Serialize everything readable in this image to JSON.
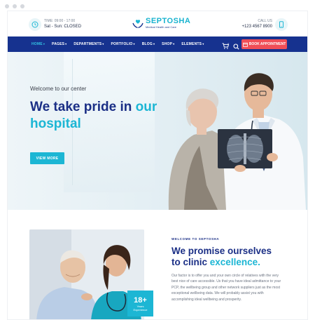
{
  "colors": {
    "primary": "#16328f",
    "accent": "#1cb6d4",
    "cta": "#f04e57"
  },
  "topbar": {
    "hours_label": "TIME: 09:00 - 17:00",
    "hours_closed": "Sat - Sun: CLOSED",
    "logo_name": "SEPTOSHA",
    "logo_tagline": "Medical Health and Care",
    "call_label": "CALL US",
    "phone": "+123 4567 8900",
    "icons": {
      "hours": "clock-icon",
      "phone": "smartphone-icon",
      "logo": "caring-hands-icon"
    }
  },
  "nav": {
    "items": [
      {
        "label": "HOME",
        "active": true
      },
      {
        "label": "PAGES"
      },
      {
        "label": "DEPARTMENTS"
      },
      {
        "label": "PORTFOLIO"
      },
      {
        "label": "BLOG"
      },
      {
        "label": "SHOP"
      },
      {
        "label": "ELEMENTS"
      }
    ],
    "cart_count": "0",
    "book_label": "BOOK APPOINTMENT"
  },
  "hero": {
    "welcome": "Welcome to our center",
    "title_line1": "We take pride in",
    "title_accent": "our",
    "title_line2": "hospital",
    "cta": "VIEW MORE"
  },
  "about": {
    "eyebrow": "WELCOME TO SEPTOSHA",
    "title_line1": "We promise ourselves",
    "title_line2_prefix": "to clinic",
    "title_accent": "excellence.",
    "body": "Our factor is to offer you and your own circle of relatives with the very best nice of care accessible. Us that you have ideal admittance to your PCP, the wellbeing group and other network suppliers just as the most exceptional wellbeing data. We will probably assist you with accomplishing ideal wellbeing and prosperity.",
    "badge_number": "18+",
    "badge_label_1": "Years",
    "badge_label_2": "Experience"
  }
}
